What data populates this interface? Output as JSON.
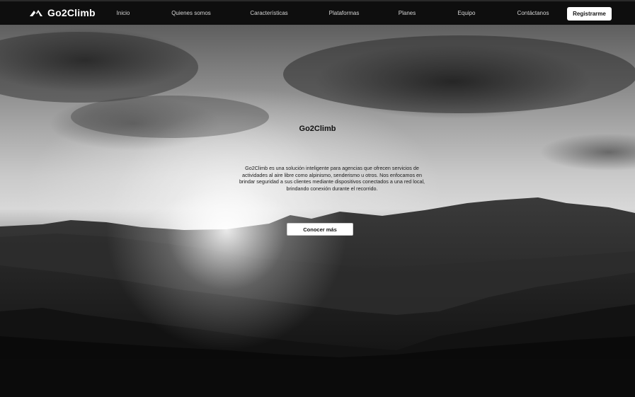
{
  "brand": {
    "name": "Go2Climb",
    "icon": "mountain-icon"
  },
  "nav": {
    "links": [
      "Inicio",
      "Quienes somos",
      "Características",
      "Plataformas",
      "Planes",
      "Equipo",
      "Contáctanos"
    ],
    "register_label": "Registrarme"
  },
  "hero": {
    "title": "Go2Climb",
    "description_lines": [
      "Go2Climb es una solución inteligente para agencias que ofrecen servicios de",
      "actividades al aire libre como alpinismo, senderismo u otros. Nos enfocamos en",
      "brindar seguridad a sus clientes mediante dispositivos conectados a una red local,",
      "brindando conexión durante el recorrido."
    ],
    "cta_label": "Conocer más"
  },
  "colors": {
    "nav_bg": "#0e0e0e",
    "button_bg": "#ffffff",
    "page_bg": "#0b0b0b"
  }
}
